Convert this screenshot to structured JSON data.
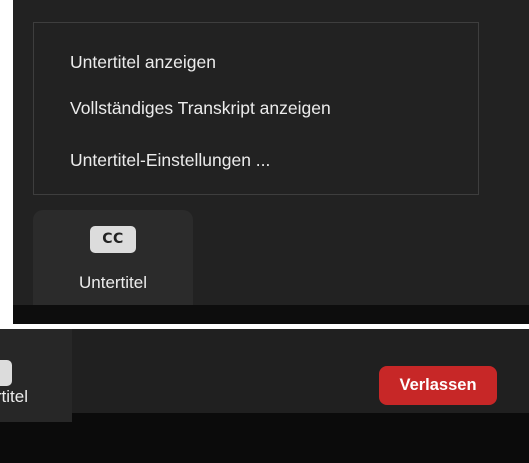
{
  "caption_menu": {
    "items": [
      {
        "label": "Untertitel anzeigen"
      },
      {
        "label": "Vollständiges Transkript anzeigen"
      },
      {
        "label": "Untertitel-Einstellungen ..."
      }
    ]
  },
  "captions_button": {
    "badge": "CC",
    "icon": "closed-captions-icon",
    "label": "Untertitel"
  },
  "toolbar": {
    "captions_button_partial_label": "Untertitel",
    "leave_button_label": "Verlassen"
  },
  "colors": {
    "background": "#222222",
    "toolbar": "#202020",
    "menu_border": "#3e3e3e",
    "text": "#ececec",
    "leave_button": "#c72727"
  }
}
